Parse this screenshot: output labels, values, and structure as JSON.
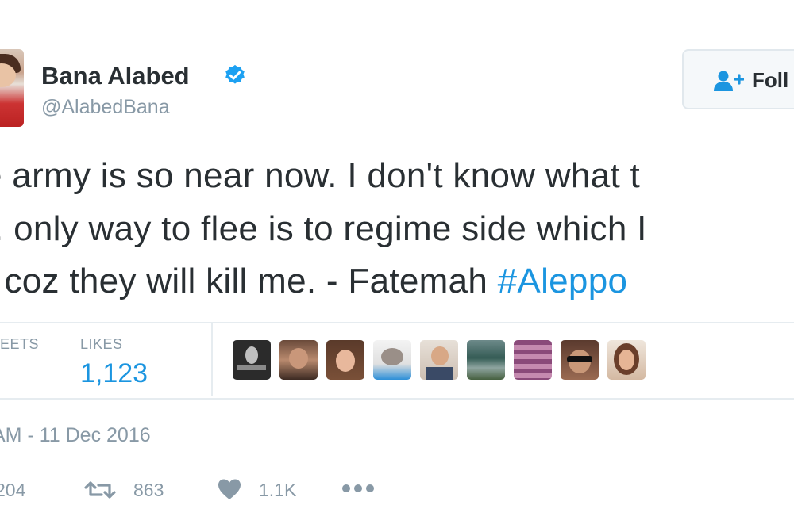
{
  "user": {
    "name": "Bana Alabed",
    "handle": "@AlabedBana",
    "verified": true
  },
  "follow_button": {
    "label": "Foll",
    "icon": "add-user-icon"
  },
  "tweet": {
    "lines": [
      "e army is so near now. I don't know what t",
      "only way to flee is to regime side which I",
      "r coz they will kill me. - Fatemah "
    ],
    "line2_prefix": ".",
    "hashtag": "#Aleppo"
  },
  "stats": {
    "retweets_label": "EETS",
    "likes_label": "LIKES",
    "likes_value": "1,123"
  },
  "likers": [
    {
      "icon": "user-avatar"
    },
    {
      "icon": "user-avatar"
    },
    {
      "icon": "user-avatar"
    },
    {
      "icon": "user-avatar"
    },
    {
      "icon": "user-avatar"
    },
    {
      "icon": "user-avatar"
    },
    {
      "icon": "user-avatar"
    },
    {
      "icon": "user-avatar"
    },
    {
      "icon": "user-avatar"
    }
  ],
  "timestamp": "AM - 11 Dec 2016",
  "actions": {
    "replies": "204",
    "retweets": "863",
    "likes": "1.1K",
    "more_icon": "more-icon"
  },
  "colors": {
    "link": "#1b95e0",
    "muted": "#8899a6",
    "text": "#292f33",
    "border": "#e6ecf0"
  }
}
